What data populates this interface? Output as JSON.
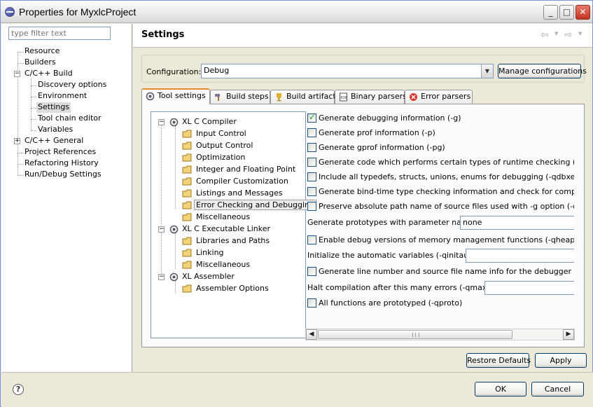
{
  "window": {
    "title": "Properties for MyxlcProject"
  },
  "left_nav": {
    "filter_placeholder": "type filter text",
    "items": [
      {
        "label": "Resource"
      },
      {
        "label": "Builders"
      },
      {
        "label": "C/C++ Build"
      },
      {
        "label": "Discovery options"
      },
      {
        "label": "Environment"
      },
      {
        "label": "Settings"
      },
      {
        "label": "Tool chain editor"
      },
      {
        "label": "Variables"
      },
      {
        "label": "C/C++ General"
      },
      {
        "label": "Project References"
      },
      {
        "label": "Refactoring History"
      },
      {
        "label": "Run/Debug Settings"
      }
    ]
  },
  "settings": {
    "title": "Settings",
    "configuration_label": "Configuration:",
    "configuration_value": "Debug",
    "manage_button": "Manage configurations"
  },
  "tabs": [
    {
      "label": "Tool settings"
    },
    {
      "label": "Build steps"
    },
    {
      "label": "Build artifact"
    },
    {
      "label": "Binary parsers"
    },
    {
      "label": "Error parsers"
    }
  ],
  "tool_tree": [
    {
      "label": "XL C Compiler"
    },
    {
      "label": "Input Control"
    },
    {
      "label": "Output Control"
    },
    {
      "label": "Optimization"
    },
    {
      "label": "Integer and Floating Point"
    },
    {
      "label": "Compiler Customization"
    },
    {
      "label": "Listings and Messages"
    },
    {
      "label": "Error Checking and Debugging"
    },
    {
      "label": "Miscellaneous"
    },
    {
      "label": "XL C Executable Linker"
    },
    {
      "label": "Libraries and Paths"
    },
    {
      "label": "Linking"
    },
    {
      "label": "Miscellaneous"
    },
    {
      "label": "XL Assembler"
    },
    {
      "label": "Assembler Options"
    }
  ],
  "options": {
    "debug_info": {
      "label": "Generate debugging information (-g)",
      "checked": true
    },
    "prof_info": {
      "label": "Generate prof information (-p)",
      "checked": false
    },
    "gprof_info": {
      "label": "Generate gprof information (-pg)",
      "checked": false
    },
    "runtime_check": {
      "label": "Generate code which performs certain types of runtime checking (-qcheck)",
      "checked": false
    },
    "typedefs": {
      "label": "Include all typedefs, structs, unions, enums for debugging (-qdbxextra)",
      "checked": false
    },
    "bindtime": {
      "label": "Generate bind-time type checking information and check for compile time correctness (-qextchk)",
      "checked": false
    },
    "fullpath": {
      "label": "Preserve absolute path name of source files used with -g option (-qfullpath)",
      "checked": false
    },
    "prototypes_label": "Generate prototypes with parameter names",
    "prototypes_value": "none",
    "heapdebug": {
      "label": "Enable debug versions of memory management functions (-qheapdebug)",
      "checked": false
    },
    "initauto_label": "Initialize the automatic variables (-qinitauto=)",
    "initauto_value": "",
    "linedebug": {
      "label": "Generate line number and source file name info for the debugger (-qlinedebug)",
      "checked": false
    },
    "maxerr_label": "Halt compilation after this many errors (-qmaxerr=)",
    "maxerr_value": "",
    "proto": {
      "label": "All functions are prototyped (-qproto)",
      "checked": false
    }
  },
  "buttons": {
    "restore_defaults": "Restore Defaults",
    "apply": "Apply",
    "ok": "OK",
    "cancel": "Cancel"
  },
  "icons": {
    "help": "?",
    "minimize": "_",
    "maximize": "□",
    "close": "✕",
    "back": "⇦",
    "forward": "⇨",
    "scroll_left": "◀",
    "scroll_right": "▶",
    "dropdown": "▼"
  },
  "colors": {
    "active_tab_accent": "#e68b2c",
    "titlebar_close": "#c2351f",
    "check": "#21a121"
  }
}
